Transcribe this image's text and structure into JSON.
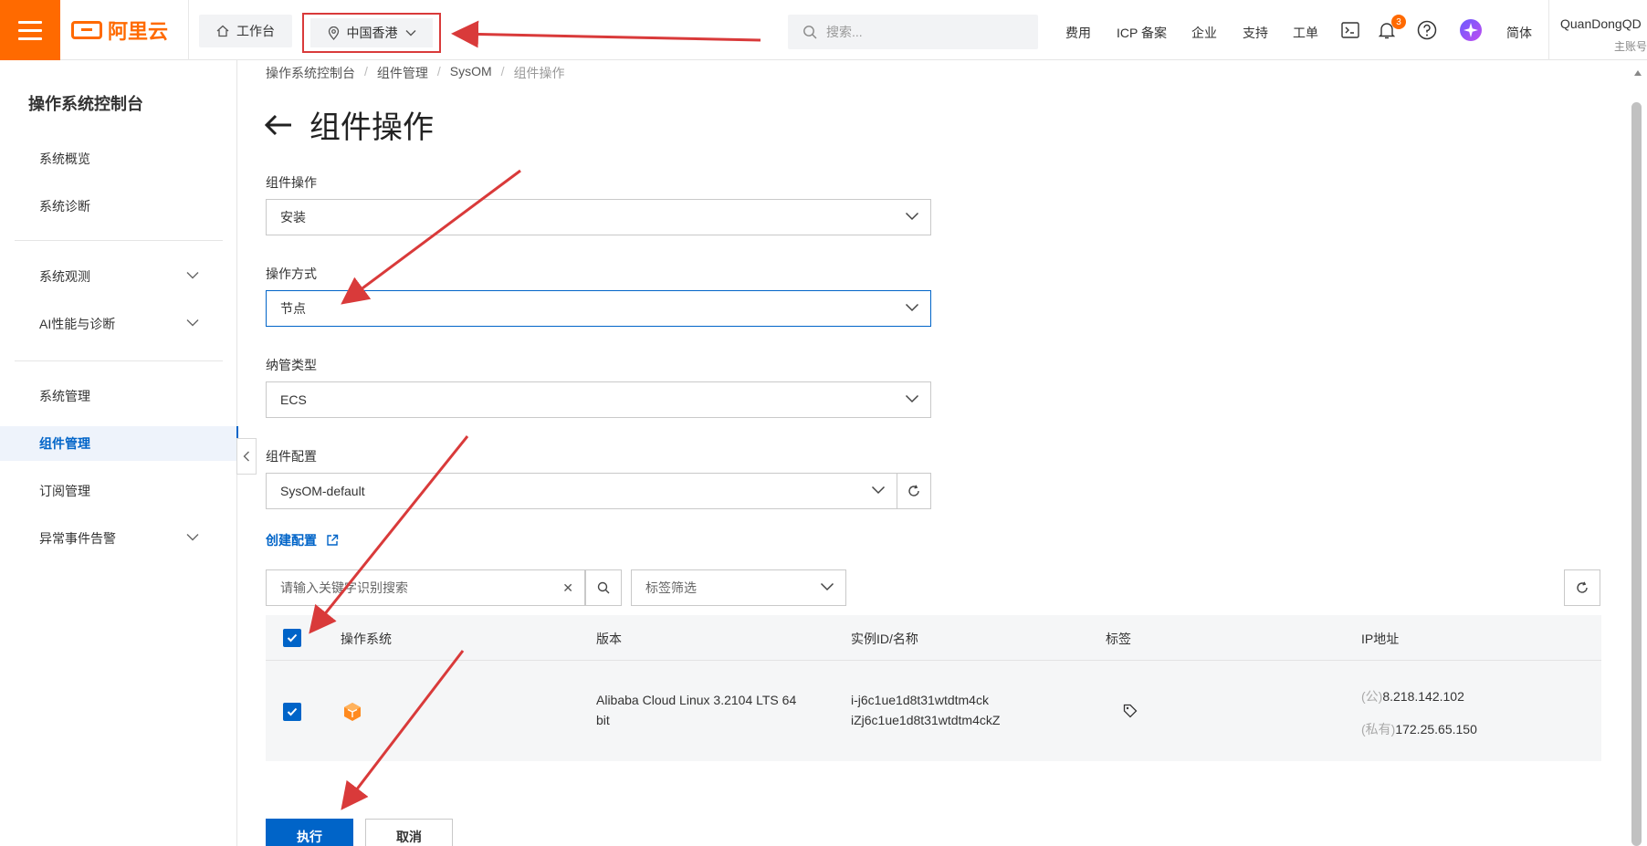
{
  "topbar": {
    "workbench": "工作台",
    "region": "中国香港",
    "search_placeholder": "搜索...",
    "nav": [
      "费用",
      "ICP 备案",
      "企业",
      "支持",
      "工单"
    ],
    "notification_count": "3",
    "language": "简体",
    "user_name": "QuanDongQD",
    "user_role": "主账号"
  },
  "sidebar": {
    "title": "操作系统控制台",
    "items": [
      {
        "label": "系统概览"
      },
      {
        "label": "系统诊断"
      },
      {
        "label": "系统观测"
      },
      {
        "label": "AI性能与诊断"
      },
      {
        "label": "系统管理"
      },
      {
        "label": "组件管理"
      },
      {
        "label": "订阅管理"
      },
      {
        "label": "异常事件告警"
      }
    ]
  },
  "breadcrumb": [
    "操作系统控制台",
    "组件管理",
    "SysOM",
    "组件操作"
  ],
  "page_title": "组件操作",
  "form": {
    "op_label": "组件操作",
    "op_value": "安装",
    "mode_label": "操作方式",
    "mode_value": "节点",
    "mgmt_label": "纳管类型",
    "mgmt_value": "ECS",
    "config_label": "组件配置",
    "config_value": "SysOM-default",
    "create_link": "创建配置"
  },
  "filters": {
    "keyword_placeholder": "请输入关键字识别搜索",
    "tag_filter": "标签筛选"
  },
  "table": {
    "columns": [
      "操作系统",
      "版本",
      "实例ID/名称",
      "标签",
      "IP地址"
    ],
    "row": {
      "version_line1": "Alibaba Cloud Linux  3.2104 LTS 64",
      "version_line2": "bit",
      "instance_id": "i-j6c1ue1d8t31wtdtm4ck",
      "instance_name": "iZj6c1ue1d8t31wtdtm4ckZ",
      "ip_public_prefix": "(公)",
      "ip_public": "8.218.142.102",
      "ip_private_prefix": "(私有)",
      "ip_private": "172.25.65.150"
    }
  },
  "actions": {
    "execute": "执行",
    "cancel": "取消"
  },
  "colors": {
    "brand": "#ff6a00",
    "primary": "#0064c8",
    "annotation": "#d93a3a"
  }
}
